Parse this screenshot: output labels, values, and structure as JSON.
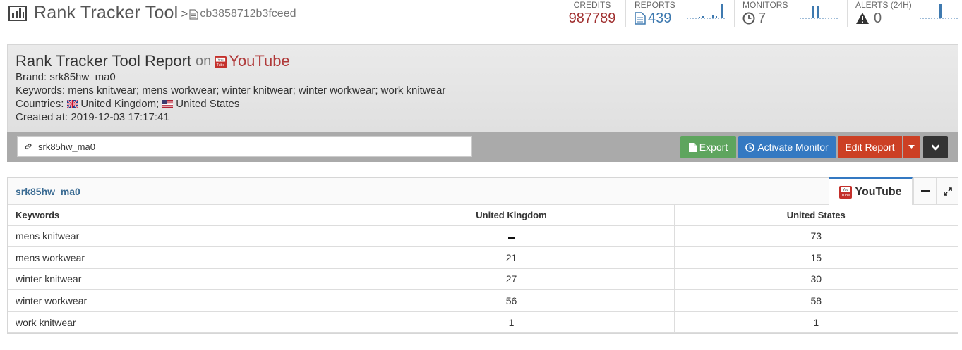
{
  "app": {
    "title": "Rank Tracker Tool",
    "breadcrumb_sep": ">",
    "report_id": "cb3858712b3fceed"
  },
  "stats": {
    "credits": {
      "label": "CREDITS",
      "value": "987789"
    },
    "reports": {
      "label": "REPORTS",
      "value": "439"
    },
    "monitors": {
      "label": "MONITORS",
      "value": "7"
    },
    "alerts": {
      "label": "ALERTS (24H)",
      "value": "0"
    }
  },
  "report": {
    "title": "Rank Tracker Tool Report",
    "on_text": "on",
    "platform": "YouTube",
    "brand_label": "Brand:",
    "brand": "srk85hw_ma0",
    "keywords_label": "Keywords:",
    "keywords": "mens knitwear; mens workwear; winter knitwear; winter workwear; work knitwear",
    "countries_label": "Countries:",
    "country_1": "United Kingdom;",
    "country_2": "United States",
    "created_label": "Created at:",
    "created_at": "2019-12-03 17:17:41"
  },
  "toolbar": {
    "search_value": "srk85hw_ma0",
    "export_label": "Export",
    "monitor_label": "Activate Monitor",
    "edit_label": "Edit Report"
  },
  "panel": {
    "title": "srk85hw_ma0",
    "tab_label": "YouTube",
    "headers": [
      "Keywords",
      "United Kingdom",
      "United States"
    ],
    "rows": [
      {
        "keyword": "mens knitwear",
        "uk": "–",
        "us": "73"
      },
      {
        "keyword": "mens workwear",
        "uk": "21",
        "us": "15"
      },
      {
        "keyword": "winter knitwear",
        "uk": "27",
        "us": "30"
      },
      {
        "keyword": "winter workwear",
        "uk": "56",
        "us": "58"
      },
      {
        "keyword": "work knitwear",
        "uk": "1",
        "us": "1"
      }
    ]
  },
  "colors": {
    "credits_value": "#a03030",
    "accent_blue": "#3479c2",
    "export_green": "#5ea55e",
    "edit_red": "#cc4024",
    "platform_red": "#b03a3a"
  },
  "icons": [
    "bar-chart-icon",
    "document-icon",
    "clock-icon",
    "warning-icon",
    "youtube-icon",
    "uk-flag-icon",
    "us-flag-icon",
    "link-icon",
    "file-icon",
    "power-icon",
    "caret-down-icon",
    "chevron-down-icon",
    "minimize-icon",
    "expand-icon"
  ]
}
